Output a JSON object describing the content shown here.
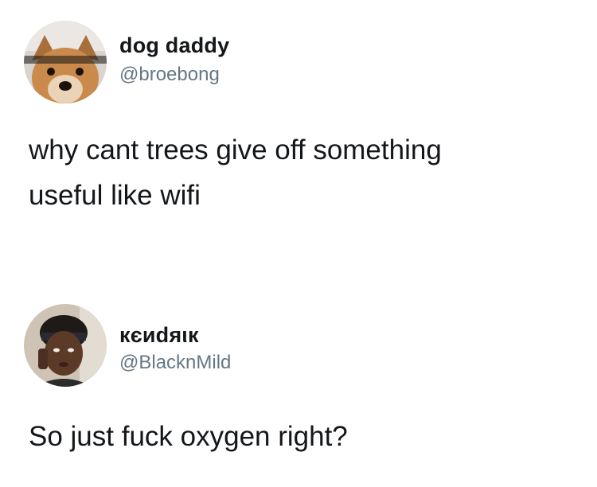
{
  "tweets": [
    {
      "display_name": "dog daddy",
      "handle": "@broebong",
      "text": "why cant trees give off something\nuseful like wifi",
      "avatar_icon": "dog-avatar"
    },
    {
      "display_name": "кєиdяιк",
      "handle": "@BlacknMild",
      "text": "So just fuck oxygen right?",
      "avatar_icon": "person-avatar"
    }
  ],
  "colors": {
    "text_primary": "#14171a",
    "text_secondary": "#657786",
    "background": "#ffffff"
  }
}
